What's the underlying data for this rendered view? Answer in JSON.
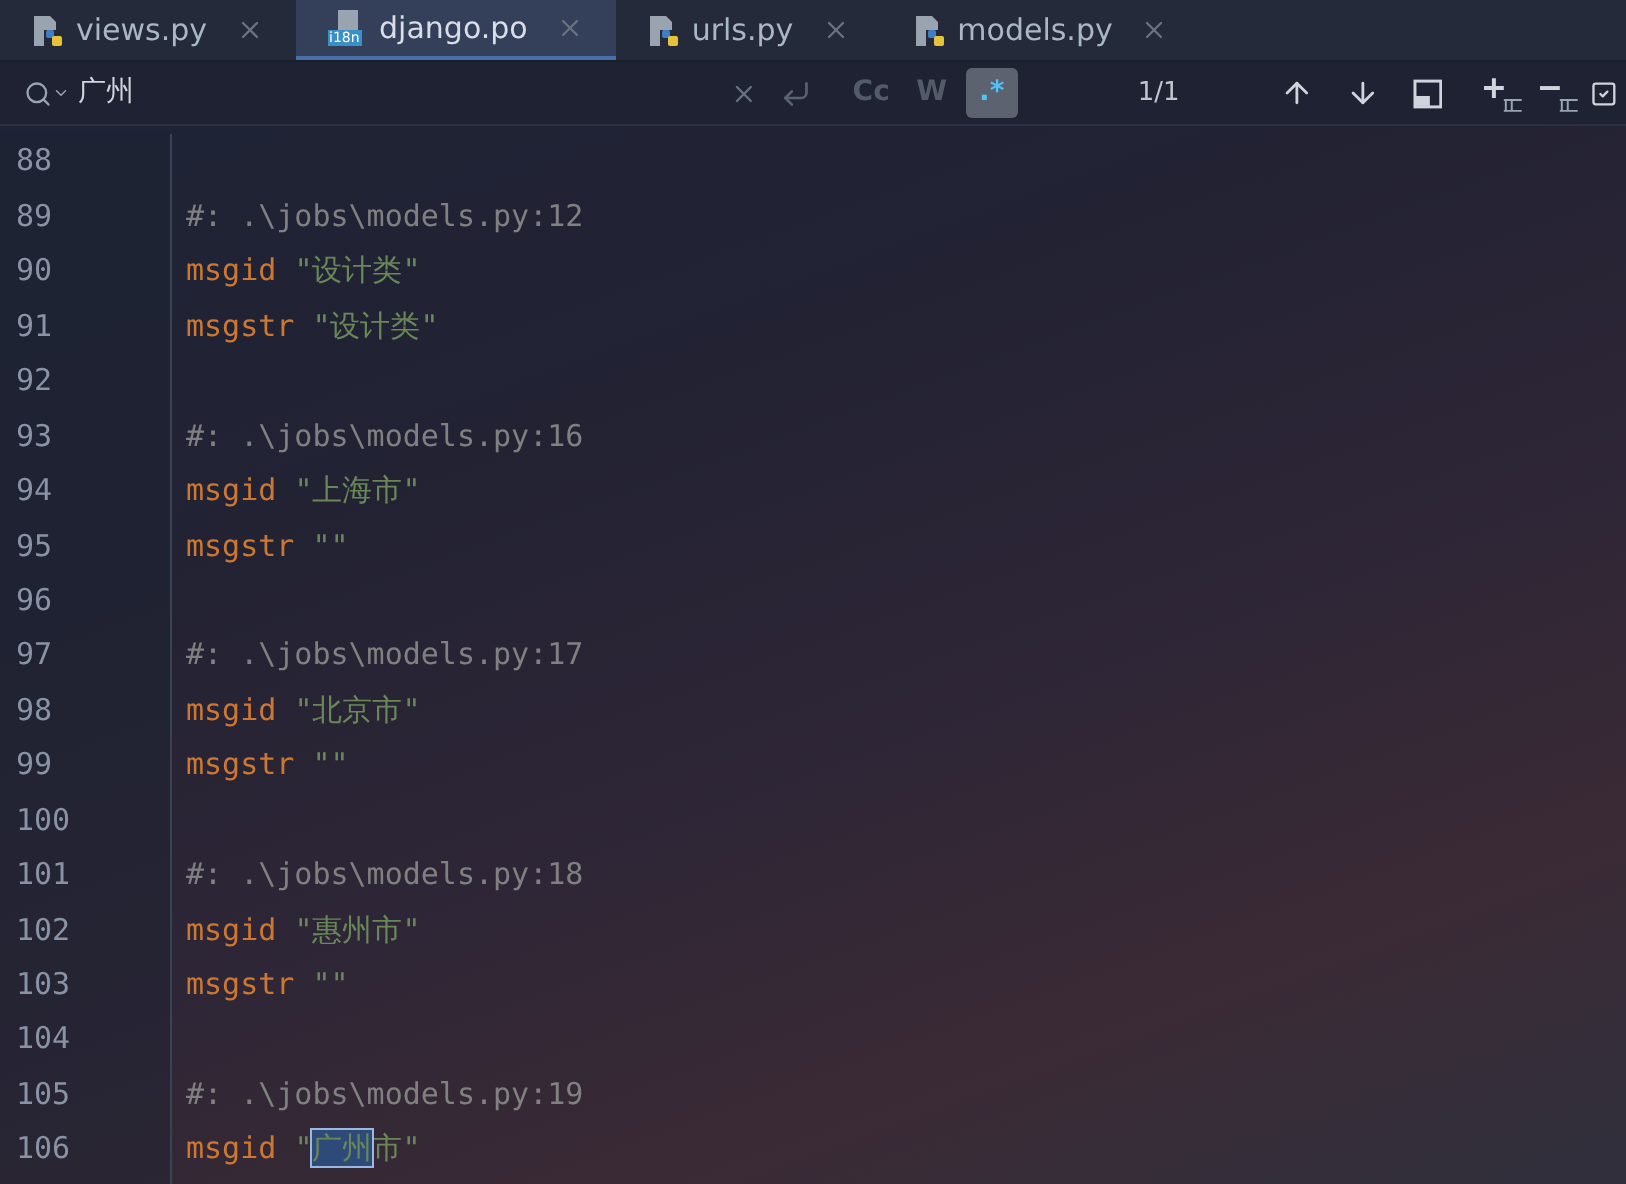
{
  "tabs": [
    {
      "label": "views.py",
      "kind": "python",
      "selected": false
    },
    {
      "label": "django.po",
      "kind": "i18n",
      "selected": true
    },
    {
      "label": "urls.py",
      "kind": "python",
      "selected": false
    },
    {
      "label": "models.py",
      "kind": "python",
      "selected": false
    }
  ],
  "i18n_badge": "i18n",
  "search": {
    "query": "广州",
    "options": [
      {
        "label": "Cc",
        "selected": false
      },
      {
        "label": "W",
        "selected": false
      },
      {
        "label": ".*",
        "selected": true
      }
    ],
    "count": "1/1"
  },
  "lines": [
    {
      "number": "88"
    },
    {
      "number": "89",
      "tokens": [
        {
          "kind": "comment",
          "text": "#: .\\jobs\\models.py:12"
        }
      ]
    },
    {
      "number": "90",
      "tokens": [
        {
          "kind": "keyword",
          "text": "msgid"
        },
        {
          "kind": "string",
          "text": "\"设计类\""
        }
      ]
    },
    {
      "number": "91",
      "tokens": [
        {
          "kind": "keyword",
          "text": "msgstr"
        },
        {
          "kind": "string",
          "text": "\"设计类\""
        }
      ]
    },
    {
      "number": "92"
    },
    {
      "number": "93",
      "tokens": [
        {
          "kind": "comment",
          "text": "#: .\\jobs\\models.py:16"
        }
      ]
    },
    {
      "number": "94",
      "tokens": [
        {
          "kind": "keyword",
          "text": "msgid"
        },
        {
          "kind": "string",
          "text": "\"上海市\""
        }
      ]
    },
    {
      "number": "95",
      "tokens": [
        {
          "kind": "keyword",
          "text": "msgstr"
        },
        {
          "kind": "string",
          "text": "\"\""
        }
      ]
    },
    {
      "number": "96"
    },
    {
      "number": "97",
      "tokens": [
        {
          "kind": "comment",
          "text": "#: .\\jobs\\models.py:17"
        }
      ]
    },
    {
      "number": "98",
      "tokens": [
        {
          "kind": "keyword",
          "text": "msgid"
        },
        {
          "kind": "string",
          "text": "\"北京市\""
        }
      ]
    },
    {
      "number": "99",
      "tokens": [
        {
          "kind": "keyword",
          "text": "msgstr"
        },
        {
          "kind": "string",
          "text": "\"\""
        }
      ]
    },
    {
      "number": "100"
    },
    {
      "number": "101",
      "tokens": [
        {
          "kind": "comment",
          "text": "#: .\\jobs\\models.py:18"
        }
      ]
    },
    {
      "number": "102",
      "tokens": [
        {
          "kind": "keyword",
          "text": "msgid"
        },
        {
          "kind": "string",
          "text": "\"惠州市\""
        }
      ]
    },
    {
      "number": "103",
      "tokens": [
        {
          "kind": "keyword",
          "text": "msgstr"
        },
        {
          "kind": "string",
          "text": "\"\""
        }
      ]
    },
    {
      "number": "104"
    },
    {
      "number": "105",
      "tokens": [
        {
          "kind": "comment",
          "text": "#: .\\jobs\\models.py:19"
        }
      ]
    },
    {
      "number": "106",
      "tokens": [
        {
          "kind": "keyword",
          "text": "msgid"
        },
        {
          "kind": "string",
          "text": "\""
        },
        {
          "kind": "match",
          "text": "广州"
        },
        {
          "kind": "string",
          "text": "市\""
        }
      ]
    }
  ]
}
